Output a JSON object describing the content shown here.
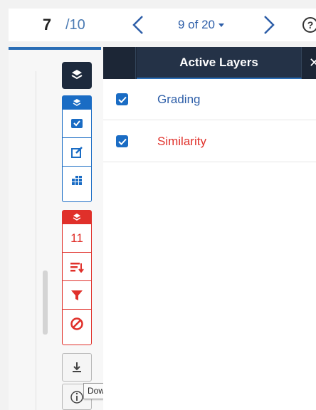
{
  "pager": {
    "current_page": "7",
    "total_pages": "/10",
    "submission_count": "9 of 20"
  },
  "layers_panel": {
    "title": "Active Layers",
    "layers": [
      {
        "label": "Grading",
        "checked": true
      },
      {
        "label": "Similarity",
        "checked": true
      }
    ]
  },
  "toolbar": {
    "similarity_match_count": "11",
    "download_tooltip": "Download"
  },
  "colors": {
    "grading_blue": "#1a6cc4",
    "similarity_red": "#e0302a",
    "panel_dark": "#1c2636"
  }
}
